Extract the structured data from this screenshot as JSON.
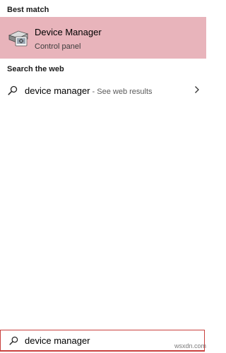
{
  "results": {
    "best_match_header": "Best match",
    "best_match": {
      "title": "Device Manager",
      "subtitle": "Control panel",
      "icon": "device-manager-icon"
    },
    "web_header": "Search the web",
    "web_result": {
      "query": "device manager",
      "suffix": " - See web results",
      "icon": "search-icon",
      "arrow_icon": "chevron-right-icon"
    }
  },
  "search": {
    "value": "device manager",
    "icon": "search-icon"
  },
  "watermark": "wsxdn.com",
  "colors": {
    "selection": "#e8b4bb",
    "search_border": "#c9403d"
  }
}
